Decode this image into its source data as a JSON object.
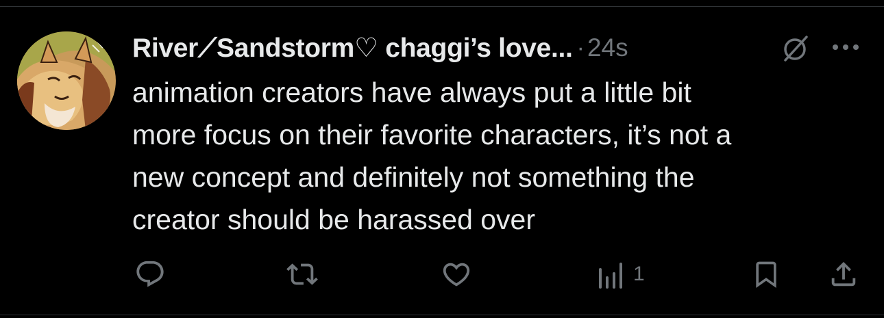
{
  "tweet": {
    "display_name": "River⟋Sandstorm♡ chaggi’s love...",
    "separator": "·",
    "timestamp": "24s",
    "text": "animation creators have always put a little bit\nmore focus on their favorite characters, it’s not a\nnew concept and definitely not something the\ncreator should be harassed over"
  },
  "actions": {
    "reply_count": "",
    "retweet_count": "",
    "like_count": "",
    "views_count": "1"
  },
  "icons": {
    "quiet": "quiet-mode-icon",
    "more": "more-options-icon",
    "reply": "reply-icon",
    "retweet": "retweet-icon",
    "like": "heart-icon",
    "views": "views-icon",
    "bookmark": "bookmark-icon",
    "share": "share-icon"
  },
  "colors": {
    "background": "#000000",
    "text": "#e7e9ea",
    "secondary": "#71767b"
  }
}
